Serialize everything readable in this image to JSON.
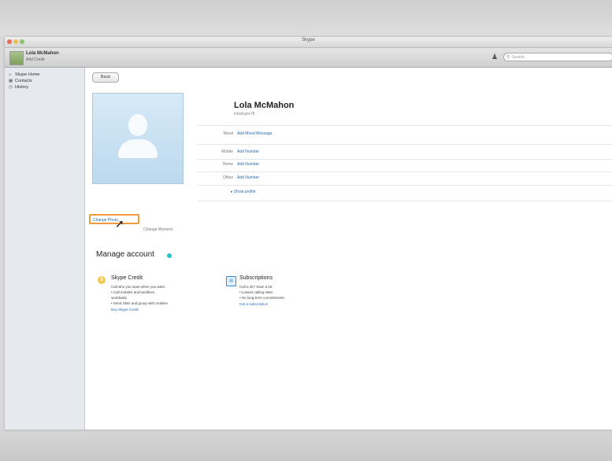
{
  "window": {
    "title": "Skype"
  },
  "toolbar": {
    "user_name": "Lola McMahon",
    "user_sub": "Add Credit",
    "search_placeholder": "Search"
  },
  "sidebar": {
    "items": [
      {
        "label": "Skype Home",
        "icon": "home-icon"
      },
      {
        "label": "Contacts",
        "icon": "contacts-icon"
      },
      {
        "label": "History",
        "icon": "history-icon"
      }
    ]
  },
  "main": {
    "back_label": "Back",
    "change_photo_label": "Change Photo",
    "photo_caption": "Change Moment",
    "profile_name": "Lola McMahon",
    "profile_sub": "lolaskype78",
    "fields": [
      {
        "label": "Mood",
        "value": "Add Mood Message"
      },
      {
        "label": "Mobile",
        "value": "Add Number"
      },
      {
        "label": "Home",
        "value": "Add Number"
      },
      {
        "label": "Office",
        "value": "Add Number"
      }
    ],
    "show_profile": "Show profile",
    "manage_title": "Manage account"
  },
  "credit": {
    "title": "Skype Credit",
    "lines": [
      "Call who you want when you want.",
      "• Call mobiles and landlines",
      "  worldwide",
      "• Send SMS and group with mobiles"
    ],
    "link": "Buy Skype Credit"
  },
  "subscriptions": {
    "title": "Subscriptions",
    "lines": [
      "Call a lot? Save a lot.",
      "• Lowest calling rates",
      "• No long-term commitments"
    ],
    "link": "Get a subscription"
  },
  "colors": {
    "accent": "#2b6db0",
    "highlight": "#f39a3e",
    "status_dot": "#2bc0c8"
  }
}
